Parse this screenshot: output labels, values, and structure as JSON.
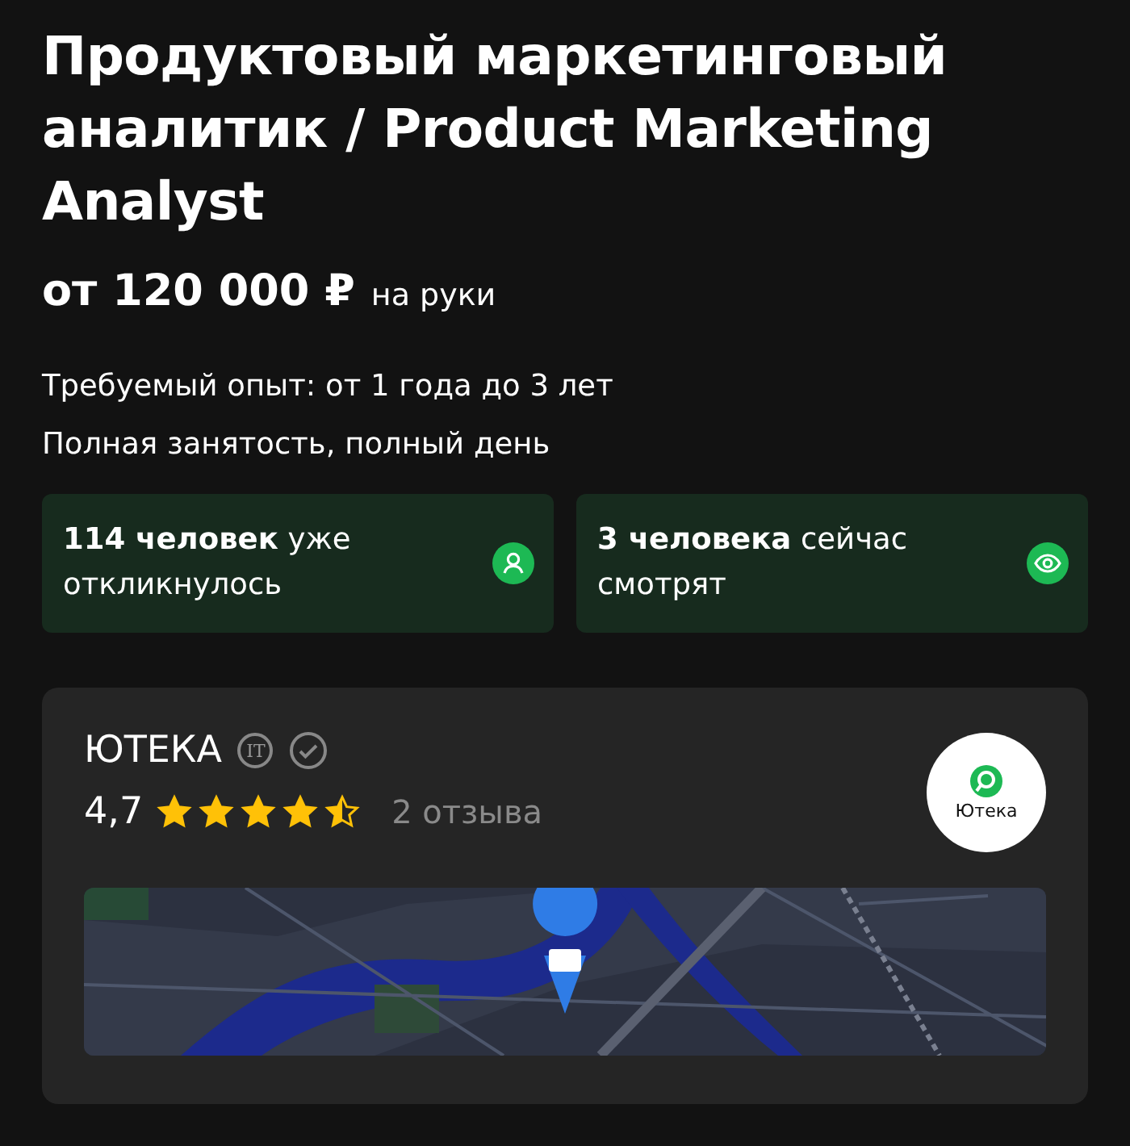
{
  "vacancy": {
    "title": "Продуктовый маркетинговый аналитик / Product Marketing Analyst",
    "salary": "от 120 000 ₽",
    "salary_note": "на руки",
    "details": [
      "Требуемый опыт: от 1 года до 3 лет",
      "Полная занятость, полный день"
    ]
  },
  "stats": [
    {
      "kind": "responses",
      "text": "**114 человек** уже откликнулось"
    },
    {
      "kind": "viewers",
      "text": "**3 человека** сейчас смотрят"
    }
  ],
  "company": {
    "name": "ЮТЕКА",
    "badge": "IT",
    "verified": true,
    "rating": "4,7",
    "stars": 4.5,
    "reviews": "2 отзыва",
    "logo_text": "Ютека"
  }
}
